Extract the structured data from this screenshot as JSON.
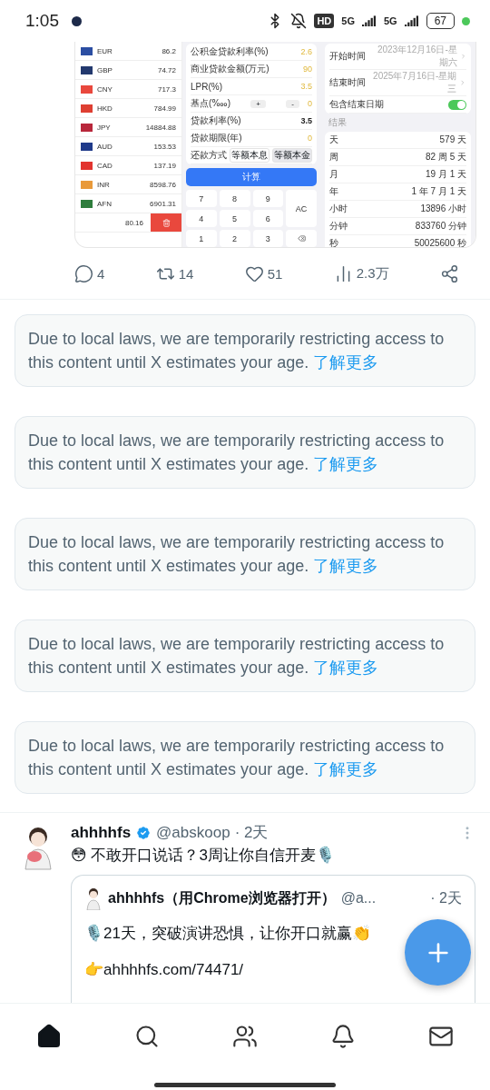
{
  "status_bar": {
    "time": "1:05",
    "hd": "HD",
    "networks": [
      "5G",
      "5G"
    ],
    "battery": "67"
  },
  "media": {
    "currencies": [
      {
        "code": "EUR",
        "amount": "86.2",
        "color": "#2b4ea2"
      },
      {
        "code": "GBP",
        "amount": "74.72",
        "color": "#23396e"
      },
      {
        "code": "CNY",
        "amount": "717.3",
        "color": "#e9483d"
      },
      {
        "code": "HKD",
        "amount": "784.99",
        "color": "#de3f32"
      },
      {
        "code": "JPY",
        "amount": "14884.88",
        "color": "#b8273b"
      },
      {
        "code": "AUD",
        "amount": "153.53",
        "color": "#1f3a8a"
      },
      {
        "code": "CAD",
        "amount": "137.19",
        "color": "#e2342f"
      },
      {
        "code": "INR",
        "amount": "8598.76",
        "color": "#e99a3a"
      },
      {
        "code": "AFN",
        "amount": "6901.31",
        "color": "#2f7d3d"
      }
    ],
    "swiped_row": {
      "amount": "80.16"
    },
    "loan_form": {
      "rows": [
        {
          "kind": "value",
          "label": "公积金贷款利率(%)",
          "value": "2.6",
          "editable": true
        },
        {
          "kind": "value",
          "label": "商业贷款金额(万元)",
          "value": "90",
          "editable": true
        },
        {
          "kind": "value",
          "label": "LPR(%)",
          "value": "3.5",
          "editable": true
        },
        {
          "kind": "stepper",
          "label": "基点(‱)",
          "buttons": [
            "+",
            "-"
          ],
          "value": "0",
          "editable": true
        },
        {
          "kind": "value",
          "label": "贷款利率(%)",
          "value": "3.5",
          "editable": false
        },
        {
          "kind": "value",
          "label": "贷款期限(年)",
          "value": "0",
          "editable": true
        },
        {
          "kind": "choice",
          "label": "还款方式",
          "options": [
            {
              "label": "等额本息",
              "selected": true
            },
            {
              "label": "等额本金",
              "selected": false
            }
          ]
        }
      ],
      "calculate": "计算"
    },
    "keypad": {
      "keys": [
        "7",
        "8",
        "9",
        "4",
        "5",
        "6",
        "1",
        "2",
        "3"
      ],
      "clear": "AC"
    },
    "date_calc": {
      "rows": [
        {
          "kind": "date",
          "label": "开始时间",
          "value": "2023年12月16日-星期六"
        },
        {
          "kind": "date",
          "label": "结束时间",
          "value": "2025年7月16日-星期三"
        },
        {
          "kind": "toggle",
          "label": "包含结束日期",
          "on": true
        }
      ],
      "result_title": "结果",
      "results": [
        {
          "label": "天",
          "value": "579 天"
        },
        {
          "label": "周",
          "value": "82 周 5 天"
        },
        {
          "label": "月",
          "value": "19 月 1 天"
        },
        {
          "label": "年",
          "value": "1 年 7 月 1 天"
        },
        {
          "label": "小时",
          "value": "13896 小时"
        },
        {
          "label": "分钟",
          "value": "833760 分钟"
        },
        {
          "label": "秒",
          "value": "50025600 秒"
        }
      ]
    }
  },
  "actions": [
    {
      "kind": "reply",
      "count": "4"
    },
    {
      "kind": "repost",
      "count": "14"
    },
    {
      "kind": "like",
      "count": "51"
    },
    {
      "kind": "views",
      "count": "2.3万"
    },
    {
      "kind": "share"
    }
  ],
  "notices": [
    {
      "text": "Due to local laws, we are temporarily restricting access to this content until X estimates your age.",
      "link": "了解更多"
    },
    {
      "text": "Due to local laws, we are temporarily restricting access to this content until X estimates your age.",
      "link": "了解更多"
    },
    {
      "text": "Due to local laws, we are temporarily restricting access to this content until X estimates your age.",
      "link": "了解更多"
    },
    {
      "text": "Due to local laws, we are temporarily restricting access to this content until X estimates your age.",
      "link": "了解更多"
    },
    {
      "text": "Due to local laws, we are temporarily restricting access to this content until X estimates your age.",
      "link": "了解更多"
    }
  ],
  "tweet": {
    "name": "ahhhhfs",
    "verified": true,
    "handle": "@abskoop",
    "time": "· 2天",
    "text": "😳 不敢开口说话？3周让你自信开麦🎙️",
    "quote": {
      "name": "ahhhhfs（用Chrome浏览器打开）",
      "handle": "@a...",
      "time": "· 2天",
      "lines": [
        "🎙️21天，突破演讲恐惧，让你开口就赢👏",
        "👉ahhhhfs.com/74471/"
      ]
    }
  },
  "nav": [
    {
      "kind": "home",
      "selected": true
    },
    {
      "kind": "search",
      "selected": false
    },
    {
      "kind": "communities",
      "selected": false
    },
    {
      "kind": "notifications",
      "selected": false
    },
    {
      "kind": "messages",
      "selected": false
    }
  ]
}
